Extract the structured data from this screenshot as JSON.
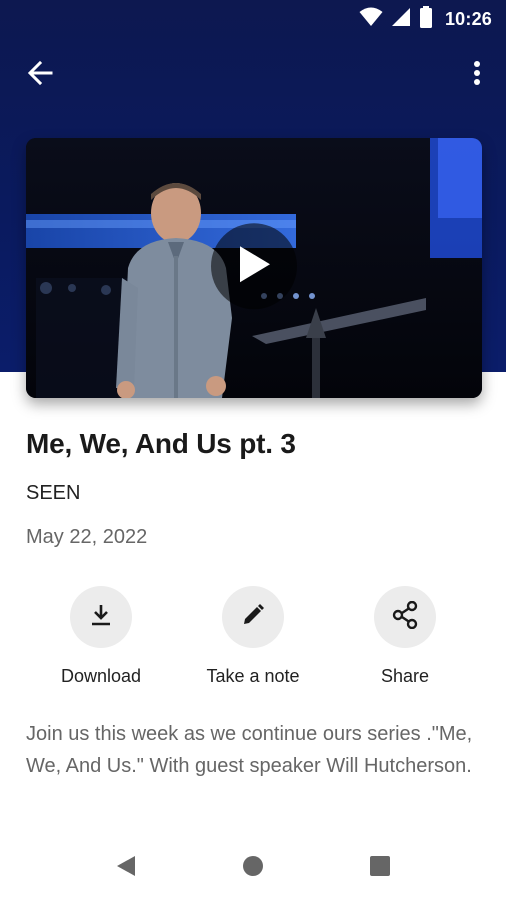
{
  "status_bar": {
    "time": "10:26",
    "icons": [
      "wifi-icon",
      "cellular-signal-icon",
      "battery-icon"
    ]
  },
  "app_bar": {
    "back_icon": "arrow-back-icon",
    "overflow_icon": "more-vert-icon"
  },
  "video": {
    "play_icon": "play-icon"
  },
  "sermon": {
    "title": "Me, We, And Us pt. 3",
    "series": "SEEN",
    "date": "May 22, 2022",
    "description": "Join us this week as we continue ours series .\"Me, We, And Us.\" With guest speaker Will Hutcherson."
  },
  "actions": [
    {
      "label": "Download",
      "icon": "download-icon"
    },
    {
      "label": "Take a note",
      "icon": "pencil-icon"
    },
    {
      "label": "Share",
      "icon": "share-icon"
    }
  ],
  "nav_bar": {
    "icons": [
      "back-triangle-icon",
      "home-circle-icon",
      "recents-square-icon"
    ]
  },
  "colors": {
    "header_bg": "#0b1d6a",
    "text_primary": "#1a1a1a",
    "text_secondary": "#666666",
    "action_circle": "#ececec"
  }
}
